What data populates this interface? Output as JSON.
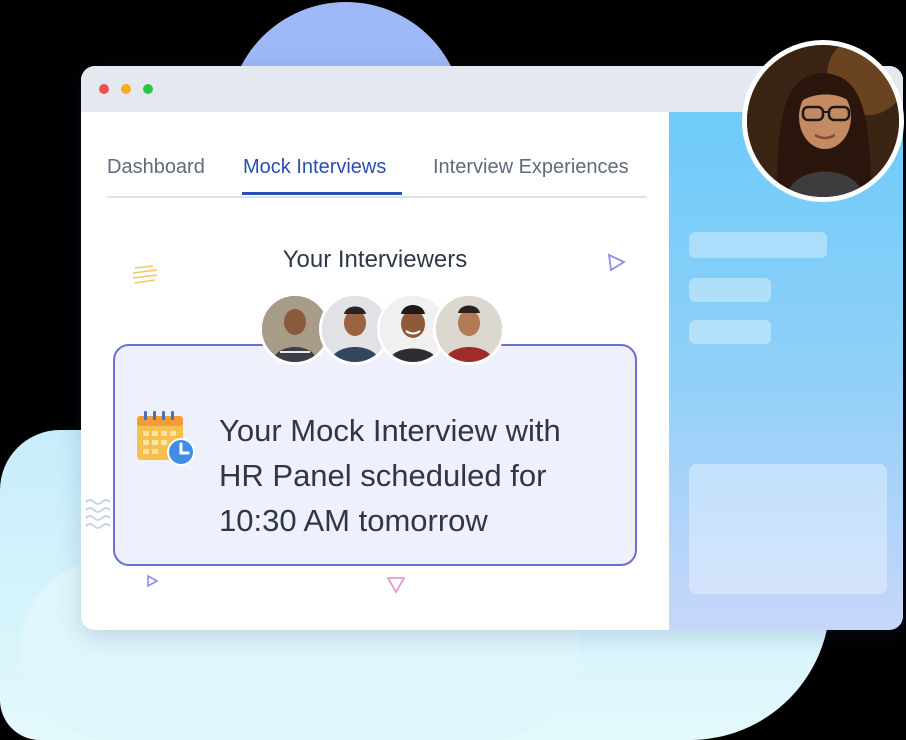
{
  "tabs": [
    {
      "label": "Dashboard",
      "active": false
    },
    {
      "label": "Mock Interviews",
      "active": true
    },
    {
      "label": "Interview Experiences",
      "active": false
    }
  ],
  "section_title": "Your Interviewers",
  "interviewers_count": 4,
  "notification": {
    "line1": "Your Mock Interview with",
    "line2": "HR Panel scheduled for",
    "line3": "10:30 AM tomorrow",
    "icon": "calendar-clock-icon"
  },
  "colors": {
    "accent": "#2a4fb3",
    "card_border": "#6a6fd3",
    "card_bg": "#eef1fc",
    "side_panel": "#6ecbfa"
  }
}
